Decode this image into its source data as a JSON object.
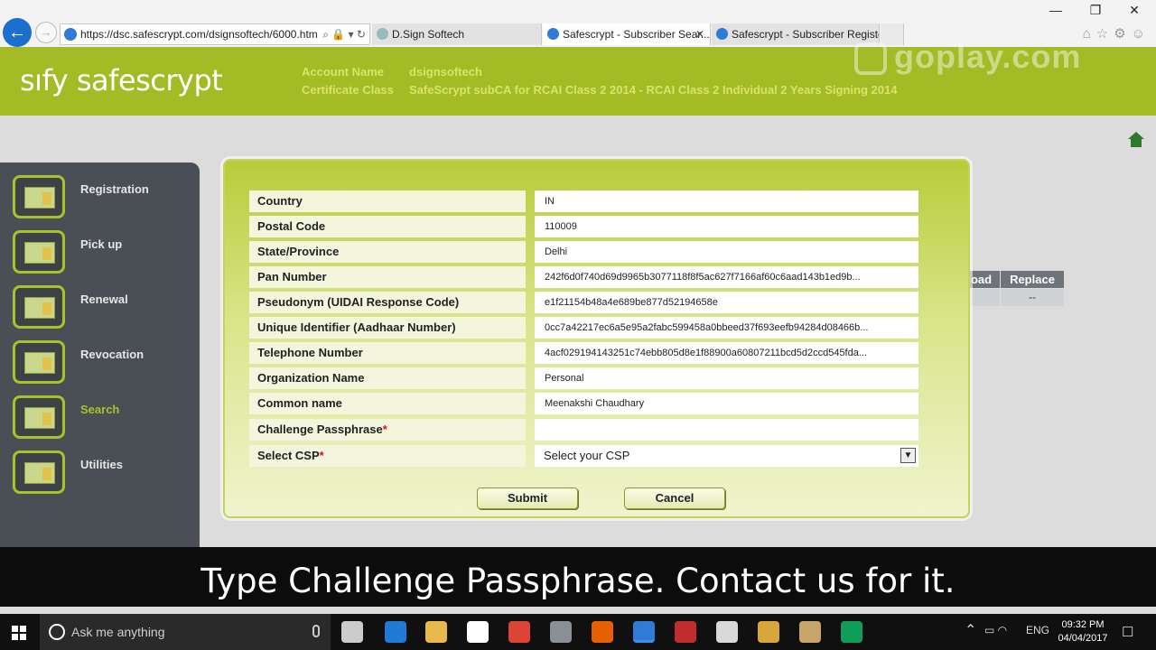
{
  "browser": {
    "url": "https://dsc.safescrypt.com/dsignsoftech/6000.htm",
    "tabs": [
      {
        "label": "D.Sign Softech"
      },
      {
        "label": "Safescrypt - Subscriber Sear..."
      },
      {
        "label": "Safescrypt - Subscriber Registe..."
      }
    ],
    "window_controls": {
      "minimize": "—",
      "restore": "❐",
      "close": "✕"
    },
    "back_glyph": "←",
    "forward_glyph": "→",
    "address_tools": "⌕ 🔒 ▾ ↻",
    "toolbar_icons": "⌂☆⚙☺"
  },
  "header": {
    "logo_text": "sıfy safescrypt",
    "account_name_label": "Account Name",
    "account_name_value": "dsignsoftech",
    "certificate_class_label": "Certificate Class",
    "certificate_class_value": "SafeScrypt subCA for RCAI Class 2 2014 - RCAI Class 2 Individual 2 Years Signing 2014",
    "watermark": "goplay.com"
  },
  "sidebar": {
    "items": [
      {
        "label": "Registration",
        "icon": "registration-icon"
      },
      {
        "label": "Pick up",
        "icon": "pickup-icon"
      },
      {
        "label": "Renewal",
        "icon": "renewal-icon"
      },
      {
        "label": "Revocation",
        "icon": "revocation-icon"
      },
      {
        "label": "Search",
        "icon": "search-icon",
        "active": true
      },
      {
        "label": "Utilities",
        "icon": "utilities-icon"
      }
    ]
  },
  "background_table": {
    "headers": [
      "oad",
      "Replace"
    ],
    "cells": [
      "",
      "--"
    ]
  },
  "form": {
    "fields": [
      {
        "label": "Country",
        "value": "IN"
      },
      {
        "label": "Postal Code",
        "value": "110009"
      },
      {
        "label": "State/Province",
        "value": "Delhi"
      },
      {
        "label": "Pan Number",
        "value": "242f6d0f740d69d9965b3077118f8f5ac627f7166af60c6aad143b1ed9b..."
      },
      {
        "label": "Pseudonym (UIDAI Response Code)",
        "value": "e1f21154b48a4e689be877d52194658e"
      },
      {
        "label": "Unique Identifier (Aadhaar Number)",
        "value": "0cc7a42217ec6a5e95a2fabc599458a0bbeed37f693eefb94284d08466b..."
      },
      {
        "label": "Telephone Number",
        "value": "4acf029194143251c74ebb805d8e1f88900a60807211bcd5d2ccd545fda..."
      },
      {
        "label": "Organization Name",
        "value": "Personal"
      },
      {
        "label": "Common name",
        "value": "Meenakshi Chaudhary"
      },
      {
        "label": "Challenge Passphrase",
        "value": "",
        "required_mark": "*"
      },
      {
        "label": "Select CSP",
        "value": "Select your CSP",
        "required_mark": "*"
      }
    ],
    "submit_label": "Submit",
    "cancel_label": "Cancel"
  },
  "caption": "Type Challenge Passphrase. Contact us for it.",
  "taskbar": {
    "search_placeholder": "Ask me anything",
    "language": "ENG",
    "time": "09:32 PM",
    "date": "04/04/2017",
    "tray_up": "⌃",
    "tray_icons": "▭ ◠",
    "notifications": "☐",
    "apps": [
      {
        "icon": "task-view-icon",
        "color": "#cccccc"
      },
      {
        "icon": "edge-icon",
        "color": "#1f7ad6"
      },
      {
        "icon": "file-explorer-icon",
        "color": "#e8b84a"
      },
      {
        "icon": "store-icon",
        "color": "#ffffff"
      },
      {
        "icon": "chrome-icon",
        "color": "#db4437"
      },
      {
        "icon": "people-icon",
        "color": "#8a8f96"
      },
      {
        "icon": "firefox-icon",
        "color": "#e66000"
      },
      {
        "icon": "internet-explorer-icon",
        "color": "#2f7bd6"
      },
      {
        "icon": "filezilla-icon",
        "color": "#bf2d2d"
      },
      {
        "icon": "mail-icon",
        "color": "#d9d9d9"
      },
      {
        "icon": "app-at-icon",
        "color": "#d9a63a"
      },
      {
        "icon": "hourglass-app-icon",
        "color": "#c7a56a"
      },
      {
        "icon": "chrome-2-icon",
        "color": "#0f9d58"
      }
    ]
  }
}
